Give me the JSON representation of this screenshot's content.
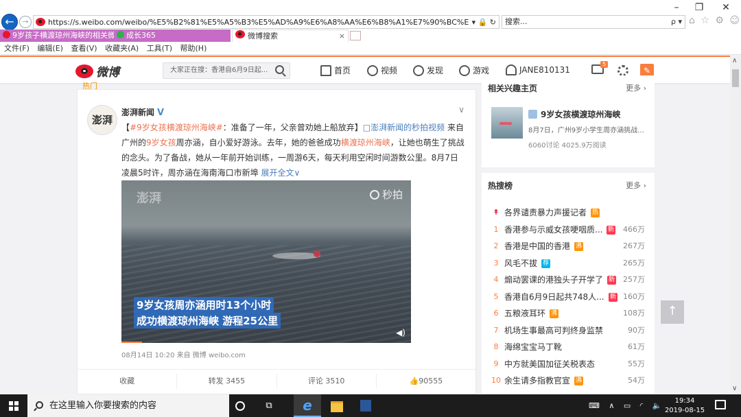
{
  "window": {
    "minimize": "–",
    "restore": "❐",
    "close": "✕"
  },
  "browser": {
    "back_icon": "←",
    "forward_icon": "→",
    "url": "https://s.weibo.com/weibo/%E5%B2%81%E5%A5%B3%E5%AD%A9%E6%A8%AA%E6%B8%A1%E7%90%BC%E5%B7%9E%E(",
    "url_icons": "▾ 🔒 ↻",
    "search_text": "搜索...",
    "search_go": "ρ ▾",
    "tools_icons": "⌂ ☆ ⚙ ☺",
    "tabs": [
      {
        "label": "9岁孩子横渡琼州海峡的相关微...",
        "icon_color": "#e6162d"
      },
      {
        "label": "成长365",
        "icon_color": "#2fb24c"
      },
      {
        "label": "微博搜索",
        "close": "×"
      }
    ],
    "menu": [
      "文件(F)",
      "编辑(E)",
      "查看(V)",
      "收藏夹(A)",
      "工具(T)",
      "帮助(H)"
    ]
  },
  "weibo": {
    "logo_text": "微博",
    "search_placeholder": "大家正在搜：香港自6月9日起...",
    "nav": {
      "home": "首页",
      "video": "视频",
      "discover": "发现",
      "game": "游戏",
      "user": "JANE810131"
    },
    "msg_badge": "5",
    "compose_icon": "✎",
    "brand_color": "#fa7d3c"
  },
  "feed": {
    "hot_label": "热门",
    "author": "澎湃新闻",
    "avatar_text": "澎湃",
    "verify": "V",
    "more_icon": "∨",
    "text": {
      "topic": "#9岁女孩横渡琼州海峡#",
      "p1": "：准备了一年，父亲曾劝她上船放弃】",
      "video_link": "□澎湃新闻的秒拍视频",
      "p2": " 来自广",
      "p2b": "州的",
      "hl1": "9岁女孩",
      "p3": "周亦涵，自小爱好游泳。去年，她的爸爸成功",
      "hl2": "横渡琼州海峡",
      "p4": "，让她也萌生了挑战的念头。为了备战，她从一年前开始训练，一周游6天，每天利用空闲时间游数公里。8月7日凌晨5时许，周亦涵在海南海口市新埠 ",
      "expand": "展开全文∨",
      "open_bracket": "【"
    },
    "video": {
      "watermark": "澎湃",
      "brand": "秒拍",
      "caption1": "9岁女孩周亦涵用时13个小时",
      "caption2": "成功横渡琼州海峡 游程25公里",
      "volume_icon": "◀)"
    },
    "meta": "08月14日 10:20  来自 微博 weibo.com",
    "actions": {
      "fav": "收藏",
      "repost": "转发 3455",
      "comment": "评论 3510",
      "like": "👍90555"
    }
  },
  "interest": {
    "title": "相关兴趣主页",
    "more": "更多 ›",
    "name": "9岁女孩横渡琼州海峡",
    "desc": "8月7日，广州9岁小学生周亦涵挑战...",
    "stat": "6060讨论 4025.9万阅读"
  },
  "hot_search": {
    "title": "热搜榜",
    "more": "更多 ›",
    "items": [
      {
        "rank": "↟",
        "title": "各界谴责暴力声援记者",
        "badge": "热",
        "badge_type": "hot",
        "count": ""
      },
      {
        "rank": "1",
        "title": "香港参与示威女孩哽咽质...",
        "badge": "新",
        "badge_type": "new",
        "count": "466万"
      },
      {
        "rank": "2",
        "title": "香港是中国的香港",
        "badge": "沸",
        "badge_type": "hot",
        "count": "267万"
      },
      {
        "rank": "3",
        "title": "风毛不拔",
        "badge": "荐",
        "badge_type": "rec",
        "count": "265万"
      },
      {
        "rank": "4",
        "title": "煽动罢课的港独头子开学了",
        "badge": "新",
        "badge_type": "new",
        "count": "257万"
      },
      {
        "rank": "5",
        "title": "香港自6月9日起共748人...",
        "badge": "新",
        "badge_type": "new",
        "count": "160万"
      },
      {
        "rank": "6",
        "title": "五粮液耳环",
        "badge": "沸",
        "badge_type": "hot",
        "count": "108万"
      },
      {
        "rank": "7",
        "title": "机场生事最高可判终身监禁",
        "badge": "",
        "badge_type": "",
        "count": "90万"
      },
      {
        "rank": "8",
        "title": "海绵宝宝马丁靴",
        "badge": "",
        "badge_type": "",
        "count": "61万"
      },
      {
        "rank": "9",
        "title": "中方就美国加征关税表态",
        "badge": "",
        "badge_type": "",
        "count": "55万"
      },
      {
        "rank": "10",
        "title": "余生请多指教官宣",
        "badge": "沸",
        "badge_type": "hot",
        "count": "54万"
      }
    ]
  },
  "page": {
    "to_top_icon": "↑",
    "scroll_up": "∧",
    "scroll_down": "∨"
  },
  "taskbar": {
    "search_placeholder": "在这里输入你要搜索的内容",
    "taskview_icon": "⧉",
    "ie_icon": "e",
    "tray": "⌨ ∧ ▭ ◜ 🔈",
    "time": "19:34",
    "date": "2019-08-15"
  }
}
